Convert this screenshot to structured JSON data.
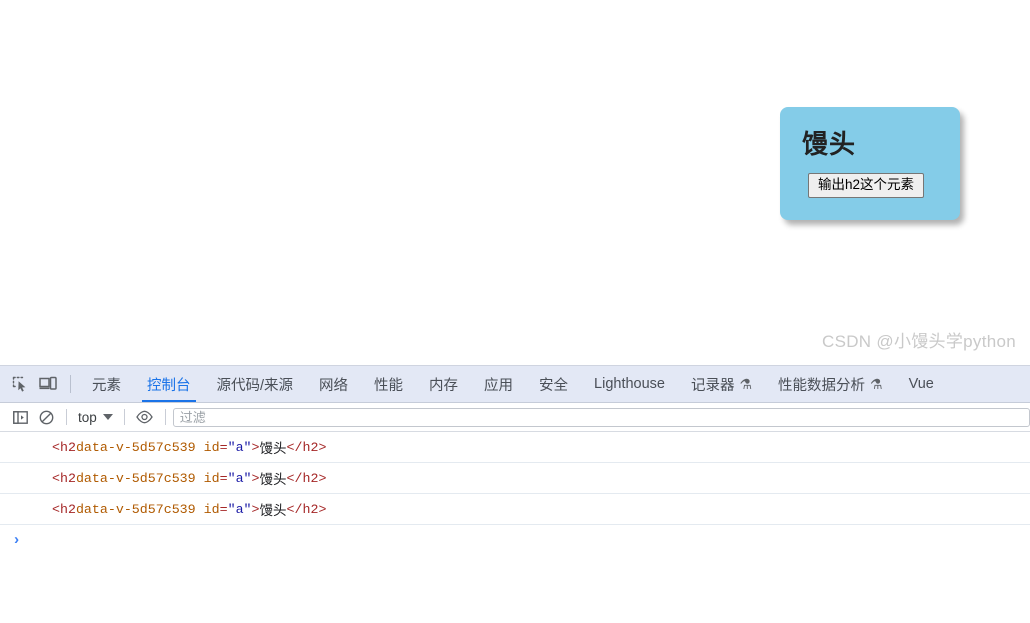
{
  "page": {
    "card": {
      "heading": "馒头",
      "button_label": "输出h2这个元素",
      "background_color": "#84cce8"
    },
    "watermark": "CSDN @小馒头学python"
  },
  "devtools": {
    "icons": {
      "inspect": "inspect-element-icon",
      "device": "device-toolbar-icon"
    },
    "tabs": [
      {
        "label": "元素",
        "active": false,
        "badge": ""
      },
      {
        "label": "控制台",
        "active": true,
        "badge": ""
      },
      {
        "label": "源代码/来源",
        "active": false,
        "badge": ""
      },
      {
        "label": "网络",
        "active": false,
        "badge": ""
      },
      {
        "label": "性能",
        "active": false,
        "badge": ""
      },
      {
        "label": "内存",
        "active": false,
        "badge": ""
      },
      {
        "label": "应用",
        "active": false,
        "badge": ""
      },
      {
        "label": "安全",
        "active": false,
        "badge": ""
      },
      {
        "label": "Lighthouse",
        "active": false,
        "badge": ""
      },
      {
        "label": "记录器",
        "active": false,
        "badge": "⚗"
      },
      {
        "label": "性能数据分析",
        "active": false,
        "badge": "⚗"
      },
      {
        "label": "Vue",
        "active": false,
        "badge": ""
      }
    ],
    "accent_color": "#1a73e8",
    "console_toolbar": {
      "sidebar_toggle_icon": "console-sidebar-icon",
      "clear_icon": "clear-console-icon",
      "context_label": "top",
      "eye_icon": "live-expression-icon",
      "filter_placeholder": "过滤",
      "filter_value": ""
    },
    "console_rows": [
      {
        "tag_open": "<h2 ",
        "attr1_name": "data-v-5d57c539",
        "attr2_name": "id",
        "attr2_value": "\"a\"",
        "tag_close_bracket": ">",
        "text": "馒头",
        "tag_end": "</h2>"
      },
      {
        "tag_open": "<h2 ",
        "attr1_name": "data-v-5d57c539",
        "attr2_name": "id",
        "attr2_value": "\"a\"",
        "tag_close_bracket": ">",
        "text": "馒头",
        "tag_end": "</h2>"
      },
      {
        "tag_open": "<h2 ",
        "attr1_name": "data-v-5d57c539",
        "attr2_name": "id",
        "attr2_value": "\"a\"",
        "tag_close_bracket": ">",
        "text": "馒头",
        "tag_end": "</h2>"
      }
    ],
    "prompt_symbol": "›"
  }
}
